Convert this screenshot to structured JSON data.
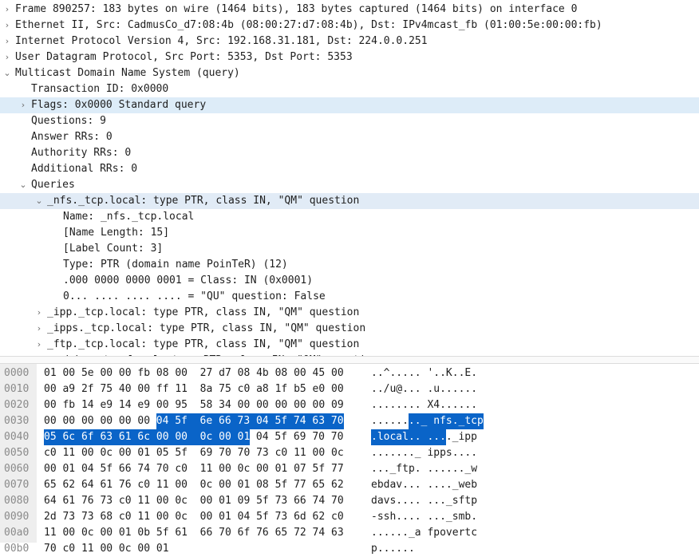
{
  "detail_tree": {
    "rows": [
      {
        "text": "Frame 890257: 183 bytes on wire (1464 bits), 183 bytes captured (1464 bits) on interface 0",
        "arrow": "›"
      },
      {
        "text": "Ethernet II, Src: CadmusCo_d7:08:4b (08:00:27:d7:08:4b), Dst: IPv4mcast_fb (01:00:5e:00:00:fb)",
        "arrow": "›"
      },
      {
        "text": "Internet Protocol Version 4, Src: 192.168.31.181, Dst: 224.0.0.251",
        "arrow": "›"
      },
      {
        "text": "User Datagram Protocol, Src Port: 5353, Dst Port: 5353",
        "arrow": "›"
      },
      {
        "text": "Multicast Domain Name System (query)",
        "arrow": "⌄"
      },
      {
        "text": "Transaction ID: 0x0000",
        "arrow": ""
      },
      {
        "text": "Flags: 0x0000 Standard query",
        "arrow": "›"
      },
      {
        "text": "Questions: 9",
        "arrow": ""
      },
      {
        "text": "Answer RRs: 0",
        "arrow": ""
      },
      {
        "text": "Authority RRs: 0",
        "arrow": ""
      },
      {
        "text": "Additional RRs: 0",
        "arrow": ""
      },
      {
        "text": "Queries",
        "arrow": "⌄"
      },
      {
        "text": "_nfs._tcp.local: type PTR, class IN, \"QM\" question",
        "arrow": "⌄"
      },
      {
        "text": "Name: _nfs._tcp.local",
        "arrow": ""
      },
      {
        "text": "[Name Length: 15]",
        "arrow": ""
      },
      {
        "text": "[Label Count: 3]",
        "arrow": ""
      },
      {
        "text": "Type: PTR (domain name PoinTeR) (12)",
        "arrow": ""
      },
      {
        "text": ".000 0000 0000 0001 = Class: IN (0x0001)",
        "arrow": ""
      },
      {
        "text": "0... .... .... .... = \"QU\" question: False",
        "arrow": ""
      },
      {
        "text": "_ipp._tcp.local: type PTR, class IN, \"QM\" question",
        "arrow": "›"
      },
      {
        "text": "_ipps._tcp.local: type PTR, class IN, \"QM\" question",
        "arrow": "›"
      },
      {
        "text": "_ftp._tcp.local: type PTR, class IN, \"QM\" question",
        "arrow": "›"
      },
      {
        "text": "_webdav._tcp.local: type PTR, class IN, \"QM\" question",
        "arrow": "›"
      }
    ]
  },
  "hex_pane": {
    "rows": [
      {
        "offset": "0000",
        "bytes": [
          "01 00 5e 00 00 fb 08 00  27 d7 08 4b 08 00 45 00"
        ],
        "ascii": [
          "..^..... '..K..E."
        ]
      },
      {
        "offset": "0010",
        "bytes": [
          "00 a9 2f 75 40 00 ff 11  8a 75 c0 a8 1f b5 e0 00"
        ],
        "ascii": [
          "../u@... .u......"
        ]
      },
      {
        "offset": "0020",
        "bytes": [
          "00 fb 14 e9 14 e9 00 95  58 34 00 00 00 00 00 09"
        ],
        "ascii": [
          "........ X4......"
        ]
      },
      {
        "offset": "0030",
        "bytes": [
          "00 00 00 00 00 00 ",
          "04 5f  6e 66 73 04 5f 74 63 70"
        ],
        "ascii": [
          "......",
          ".._ nfs._tcp"
        ]
      },
      {
        "offset": "0040",
        "bytes": [
          "05 6c 6f 63 61 6c 00 00  0c 00 01",
          " 04 5f 69 70 70"
        ],
        "ascii": [
          ".local.. ...",
          "._ipp"
        ]
      },
      {
        "offset": "0050",
        "bytes": [
          "c0 11 00 0c 00 01 05 5f  69 70 70 73 c0 11 00 0c"
        ],
        "ascii": [
          "......._ ipps...."
        ]
      },
      {
        "offset": "0060",
        "bytes": [
          "00 01 04 5f 66 74 70 c0  11 00 0c 00 01 07 5f 77"
        ],
        "ascii": [
          "..._ftp. ......_w"
        ]
      },
      {
        "offset": "0070",
        "bytes": [
          "65 62 64 61 76 c0 11 00  0c 00 01 08 5f 77 65 62"
        ],
        "ascii": [
          "ebdav... ...._web"
        ]
      },
      {
        "offset": "0080",
        "bytes": [
          "64 61 76 73 c0 11 00 0c  00 01 09 5f 73 66 74 70"
        ],
        "ascii": [
          "davs.... ..._sftp"
        ]
      },
      {
        "offset": "0090",
        "bytes": [
          "2d 73 73 68 c0 11 00 0c  00 01 04 5f 73 6d 62 c0"
        ],
        "ascii": [
          "-ssh.... ..._smb."
        ]
      },
      {
        "offset": "00a0",
        "bytes": [
          "11 00 0c 00 01 0b 5f 61  66 70 6f 76 65 72 74 63"
        ],
        "ascii": [
          "......_a fpovertc"
        ]
      },
      {
        "offset": "00b0",
        "bytes": [
          "70 c0 11 00 0c 00 01"
        ],
        "ascii": [
          "p......"
        ]
      }
    ]
  }
}
